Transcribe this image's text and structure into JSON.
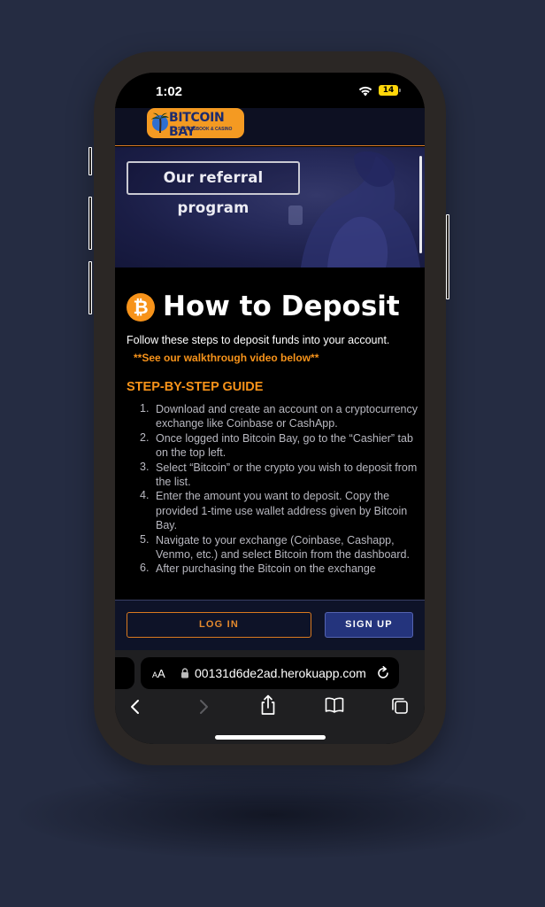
{
  "status_bar": {
    "time": "1:02",
    "battery": "14"
  },
  "site": {
    "logo_title": "BITCOIN BAY",
    "logo_subtitle": "SPORTSBOOK & CASINO",
    "referral_label": "Our referral program"
  },
  "content": {
    "title": "How to Deposit",
    "intro": "Follow these steps to deposit funds into your account.",
    "video_note": "**See our walkthrough video below**",
    "guide_heading": "STEP-BY-STEP GUIDE",
    "steps": [
      {
        "num": "1.",
        "text": "Download and create an account on a cryptocurrency exchange like Coinbase or CashApp."
      },
      {
        "num": "2.",
        "text": "Once logged into Bitcoin Bay, go to the “Cashier” tab on the top left."
      },
      {
        "num": "3.",
        "text": "Select “Bitcoin” or the crypto you wish to deposit from the list."
      },
      {
        "num": "4.",
        "text": "Enter the amount you want to deposit. Copy the provided 1-time use wallet address given by Bitcoin Bay."
      },
      {
        "num": "5.",
        "text": "Navigate to your exchange (Coinbase, Cashapp, Venmo, etc.) and select Bitcoin from the dashboard."
      },
      {
        "num": "6.",
        "text": "After purchasing the Bitcoin on the exchange"
      }
    ]
  },
  "auth": {
    "login_label": "LOG IN",
    "signup_label": "SIGN UP"
  },
  "browser": {
    "text_size_label": "AA",
    "url": "00131d6de2ad.herokuapp.com",
    "icons": [
      "back-icon",
      "forward-icon",
      "share-icon",
      "bookmarks-icon",
      "tabs-icon",
      "reload-icon",
      "lock-icon"
    ]
  },
  "colors": {
    "background": "#252c42",
    "accent_orange": "#f7931a",
    "signup_blue": "#24347d",
    "header_navy": "#0d1022"
  }
}
